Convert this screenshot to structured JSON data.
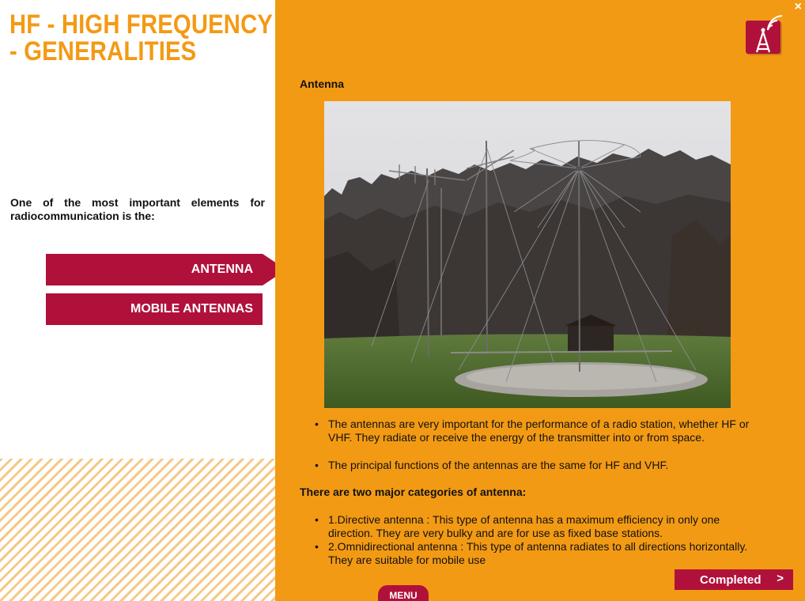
{
  "header": {
    "title_line1": "HF - HIGH FREQUENCY",
    "title_line2": "- GENERALITIES"
  },
  "intro_text": "One of the most important elements for radiocommunication is the:",
  "nav": {
    "items": [
      {
        "label": "ANTENNA",
        "active": true
      },
      {
        "label": "MOBILE ANTENNAS",
        "active": false
      }
    ]
  },
  "content": {
    "section_title": "Antenna",
    "bullets": [
      "The antennas are very important for the performance of a radio station, whether HF or VHF. They radiate or receive the energy of the transmitter into or from space.",
      "The principal functions of the antennas are the same for HF and VHF."
    ],
    "subheading": "There are two major categories of antenna:",
    "categories": [
      "1.Directive antenna : This type of antenna has a maximum efficiency in only one direction. They are very bulky and are for use as fixed base stations.",
      "2.Omnidirectional antenna : This type of antenna radiates to all directions horizontally. They are suitable for mobile use"
    ]
  },
  "controls": {
    "close_label": "×",
    "completed_label": "Completed",
    "completed_arrow": ">",
    "menu_label": "MENU"
  },
  "colors": {
    "accent_orange": "#f39a14",
    "crimson": "#b0113b",
    "stripe": "#f4c987"
  },
  "icons": {
    "logo": "antenna-tower-icon",
    "close": "close-icon",
    "next": "chevron-right-icon"
  }
}
